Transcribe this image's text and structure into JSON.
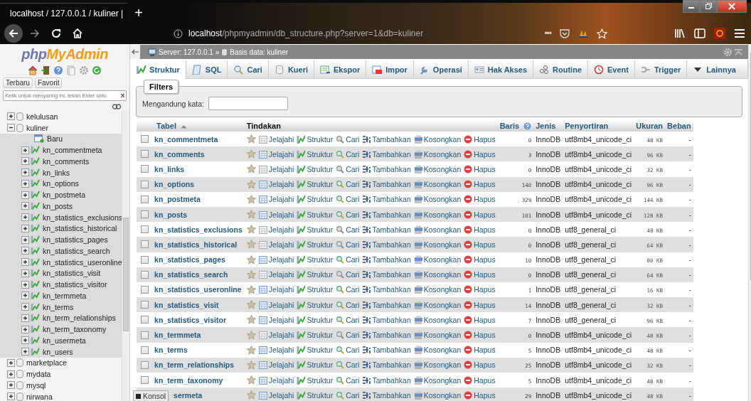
{
  "browser": {
    "tab_title": "localhost / 127.0.0.1 / kuliner |",
    "new_tab": "+",
    "url": {
      "host": "localhost",
      "path": "/phpmyadmin/db_structure.php?server=1&db=kuliner"
    },
    "overflow_menu": "•••"
  },
  "sidebar": {
    "logo": {
      "prefix": "php",
      "suffix": "MyAdmin"
    },
    "buttons": [
      {
        "label": "Terbaru"
      },
      {
        "label": "Favorit"
      }
    ],
    "filter": {
      "placeholder": "Ketik untuk menyaring ini, tekan Enter untu",
      "clear": "X"
    },
    "tree": [
      {
        "label": "kelulusan",
        "kind": "database",
        "expanded": false
      },
      {
        "label": "kuliner",
        "kind": "database",
        "expanded": true,
        "children": [
          {
            "label": "Baru",
            "kind": "new"
          },
          {
            "label": "kn_commentmeta",
            "kind": "table",
            "expanded": false
          },
          {
            "label": "kn_comments",
            "kind": "table",
            "expanded": false
          },
          {
            "label": "kn_links",
            "kind": "table",
            "expanded": false
          },
          {
            "label": "kn_options",
            "kind": "table",
            "expanded": false
          },
          {
            "label": "kn_postmeta",
            "kind": "table",
            "expanded": false
          },
          {
            "label": "kn_posts",
            "kind": "table",
            "expanded": false
          },
          {
            "label": "kn_statistics_exclusions",
            "kind": "table",
            "expanded": false
          },
          {
            "label": "kn_statistics_historical",
            "kind": "table",
            "expanded": false
          },
          {
            "label": "kn_statistics_pages",
            "kind": "table",
            "expanded": false
          },
          {
            "label": "kn_statistics_search",
            "kind": "table",
            "expanded": false
          },
          {
            "label": "kn_statistics_useronline",
            "kind": "table",
            "expanded": false
          },
          {
            "label": "kn_statistics_visit",
            "kind": "table",
            "expanded": false
          },
          {
            "label": "kn_statistics_visitor",
            "kind": "table",
            "expanded": false
          },
          {
            "label": "kn_termmeta",
            "kind": "table",
            "expanded": false
          },
          {
            "label": "kn_terms",
            "kind": "table",
            "expanded": false
          },
          {
            "label": "kn_term_relationships",
            "kind": "table",
            "expanded": false
          },
          {
            "label": "kn_term_taxonomy",
            "kind": "table",
            "expanded": false
          },
          {
            "label": "kn_usermeta",
            "kind": "table",
            "expanded": false
          },
          {
            "label": "kn_users",
            "kind": "table",
            "expanded": false
          }
        ]
      },
      {
        "label": "marketplace",
        "kind": "database",
        "expanded": false
      },
      {
        "label": "mydata",
        "kind": "database",
        "expanded": false
      },
      {
        "label": "mysql",
        "kind": "database",
        "expanded": false
      },
      {
        "label": "nirwana",
        "kind": "database",
        "expanded": false
      }
    ]
  },
  "breadcrumb": {
    "server": "Server: 127.0.0.1",
    "separator": "»",
    "database": "Basis data: kuliner"
  },
  "tabs": [
    {
      "label": "Struktur",
      "selected": true
    },
    {
      "label": "SQL",
      "selected": false
    },
    {
      "label": "Cari",
      "selected": false
    },
    {
      "label": "Kueri",
      "selected": false
    },
    {
      "label": "Ekspor",
      "selected": false
    },
    {
      "label": "Impor",
      "selected": false
    },
    {
      "label": "Operasi",
      "selected": false
    },
    {
      "label": "Hak Akses",
      "selected": false
    },
    {
      "label": "Routine",
      "selected": false
    },
    {
      "label": "Event",
      "selected": false
    },
    {
      "label": "Trigger",
      "selected": false
    },
    {
      "label": "Lainnya",
      "selected": false
    }
  ],
  "filters": {
    "legend": "Filters",
    "label": "Mengandung kata:"
  },
  "table": {
    "columns": [
      "Tabel",
      "Tindakan",
      "Baris",
      "Jenis",
      "Penyortiran",
      "Ukuran",
      "Beban"
    ],
    "rows": [
      {
        "checked": false,
        "name": "kn_commentmeta",
        "empty": true,
        "actions": [
          "Jelajahi",
          "Struktur",
          "Cari",
          "Tambahkan",
          "Kosongkan",
          "Hapus"
        ],
        "rows": "0",
        "engine": "InnoDB",
        "collation": "utf8mb4_unicode_ci",
        "size": "48 KB",
        "overhead": "-"
      },
      {
        "checked": false,
        "name": "kn_comments",
        "empty": false,
        "actions": [
          "Jelajahi",
          "Struktur",
          "Cari",
          "Tambahkan",
          "Kosongkan",
          "Hapus"
        ],
        "rows": "3",
        "engine": "InnoDB",
        "collation": "utf8mb4_unicode_ci",
        "size": "96 KB",
        "overhead": "-"
      },
      {
        "checked": false,
        "name": "kn_links",
        "empty": true,
        "actions": [
          "Jelajahi",
          "Struktur",
          "Cari",
          "Tambahkan",
          "Kosongkan",
          "Hapus"
        ],
        "rows": "0",
        "engine": "InnoDB",
        "collation": "utf8mb4_unicode_ci",
        "size": "32 KB",
        "overhead": "-"
      },
      {
        "checked": false,
        "name": "kn_options",
        "empty": false,
        "actions": [
          "Jelajahi",
          "Struktur",
          "Cari",
          "Tambahkan",
          "Kosongkan",
          "Hapus"
        ],
        "rows": "140",
        "engine": "InnoDB",
        "collation": "utf8mb4_unicode_ci",
        "size": "96 KB",
        "overhead": "-"
      },
      {
        "checked": false,
        "name": "kn_postmeta",
        "empty": false,
        "actions": [
          "Jelajahi",
          "Struktur",
          "Cari",
          "Tambahkan",
          "Kosongkan",
          "Hapus"
        ],
        "rows": "329",
        "engine": "InnoDB",
        "collation": "utf8mb4_unicode_ci",
        "size": "144 KB",
        "overhead": "-"
      },
      {
        "checked": false,
        "name": "kn_posts",
        "empty": false,
        "actions": [
          "Jelajahi",
          "Struktur",
          "Cari",
          "Tambahkan",
          "Kosongkan",
          "Hapus"
        ],
        "rows": "101",
        "engine": "InnoDB",
        "collation": "utf8mb4_unicode_ci",
        "size": "128 KB",
        "overhead": "-"
      },
      {
        "checked": false,
        "name": "kn_statistics_exclusions",
        "empty": true,
        "actions": [
          "Jelajahi",
          "Struktur",
          "Cari",
          "Tambahkan",
          "Kosongkan",
          "Hapus"
        ],
        "rows": "0",
        "engine": "InnoDB",
        "collation": "utf8_general_ci",
        "size": "48 KB",
        "overhead": "-"
      },
      {
        "checked": false,
        "name": "kn_statistics_historical",
        "empty": true,
        "actions": [
          "Jelajahi",
          "Struktur",
          "Cari",
          "Tambahkan",
          "Kosongkan",
          "Hapus"
        ],
        "rows": "0",
        "engine": "InnoDB",
        "collation": "utf8_general_ci",
        "size": "64 KB",
        "overhead": "-"
      },
      {
        "checked": false,
        "name": "kn_statistics_pages",
        "empty": false,
        "actions": [
          "Jelajahi",
          "Struktur",
          "Cari",
          "Tambahkan",
          "Kosongkan",
          "Hapus"
        ],
        "rows": "10",
        "engine": "InnoDB",
        "collation": "utf8_general_ci",
        "size": "80 KB",
        "overhead": "-"
      },
      {
        "checked": false,
        "name": "kn_statistics_search",
        "empty": true,
        "actions": [
          "Jelajahi",
          "Struktur",
          "Cari",
          "Tambahkan",
          "Kosongkan",
          "Hapus"
        ],
        "rows": "0",
        "engine": "InnoDB",
        "collation": "utf8_general_ci",
        "size": "64 KB",
        "overhead": "-"
      },
      {
        "checked": false,
        "name": "kn_statistics_useronline",
        "empty": false,
        "actions": [
          "Jelajahi",
          "Struktur",
          "Cari",
          "Tambahkan",
          "Kosongkan",
          "Hapus"
        ],
        "rows": "1",
        "engine": "InnoDB",
        "collation": "utf8_general_ci",
        "size": "16 KB",
        "overhead": "-"
      },
      {
        "checked": false,
        "name": "kn_statistics_visit",
        "empty": false,
        "actions": [
          "Jelajahi",
          "Struktur",
          "Cari",
          "Tambahkan",
          "Kosongkan",
          "Hapus"
        ],
        "rows": "14",
        "engine": "InnoDB",
        "collation": "utf8_general_ci",
        "size": "32 KB",
        "overhead": "-"
      },
      {
        "checked": false,
        "name": "kn_statistics_visitor",
        "empty": false,
        "actions": [
          "Jelajahi",
          "Struktur",
          "Cari",
          "Tambahkan",
          "Kosongkan",
          "Hapus"
        ],
        "rows": "7",
        "engine": "InnoDB",
        "collation": "utf8_general_ci",
        "size": "96 KB",
        "overhead": "-"
      },
      {
        "checked": false,
        "name": "kn_termmeta",
        "empty": true,
        "actions": [
          "Jelajahi",
          "Struktur",
          "Cari",
          "Tambahkan",
          "Kosongkan",
          "Hapus"
        ],
        "rows": "0",
        "engine": "InnoDB",
        "collation": "utf8mb4_unicode_ci",
        "size": "48 KB",
        "overhead": "-"
      },
      {
        "checked": false,
        "name": "kn_terms",
        "empty": false,
        "actions": [
          "Jelajahi",
          "Struktur",
          "Cari",
          "Tambahkan",
          "Kosongkan",
          "Hapus"
        ],
        "rows": "5",
        "engine": "InnoDB",
        "collation": "utf8mb4_unicode_ci",
        "size": "48 KB",
        "overhead": "-"
      },
      {
        "checked": false,
        "name": "kn_term_relationships",
        "empty": false,
        "actions": [
          "Jelajahi",
          "Struktur",
          "Cari",
          "Tambahkan",
          "Kosongkan",
          "Hapus"
        ],
        "rows": "25",
        "engine": "InnoDB",
        "collation": "utf8mb4_unicode_ci",
        "size": "32 KB",
        "overhead": "-"
      },
      {
        "checked": false,
        "name": "kn_term_taxonomy",
        "empty": false,
        "actions": [
          "Jelajahi",
          "Struktur",
          "Cari",
          "Tambahkan",
          "Kosongkan",
          "Hapus"
        ],
        "rows": "5",
        "engine": "InnoDB",
        "collation": "utf8mb4_unicode_ci",
        "size": "48 KB",
        "overhead": "-"
      },
      {
        "name": "sermeta",
        "empty": false,
        "actions": [
          "Jelajahi",
          "Struktur",
          "Cari",
          "Tambahkan",
          "Kosongkan",
          "Hapus"
        ],
        "rows": "29",
        "engine": "InnoDB",
        "collation": "utf8mb4_unicode_ci",
        "size": "48 KB",
        "overhead": "-"
      }
    ]
  },
  "console": {
    "label": "Konsol"
  }
}
